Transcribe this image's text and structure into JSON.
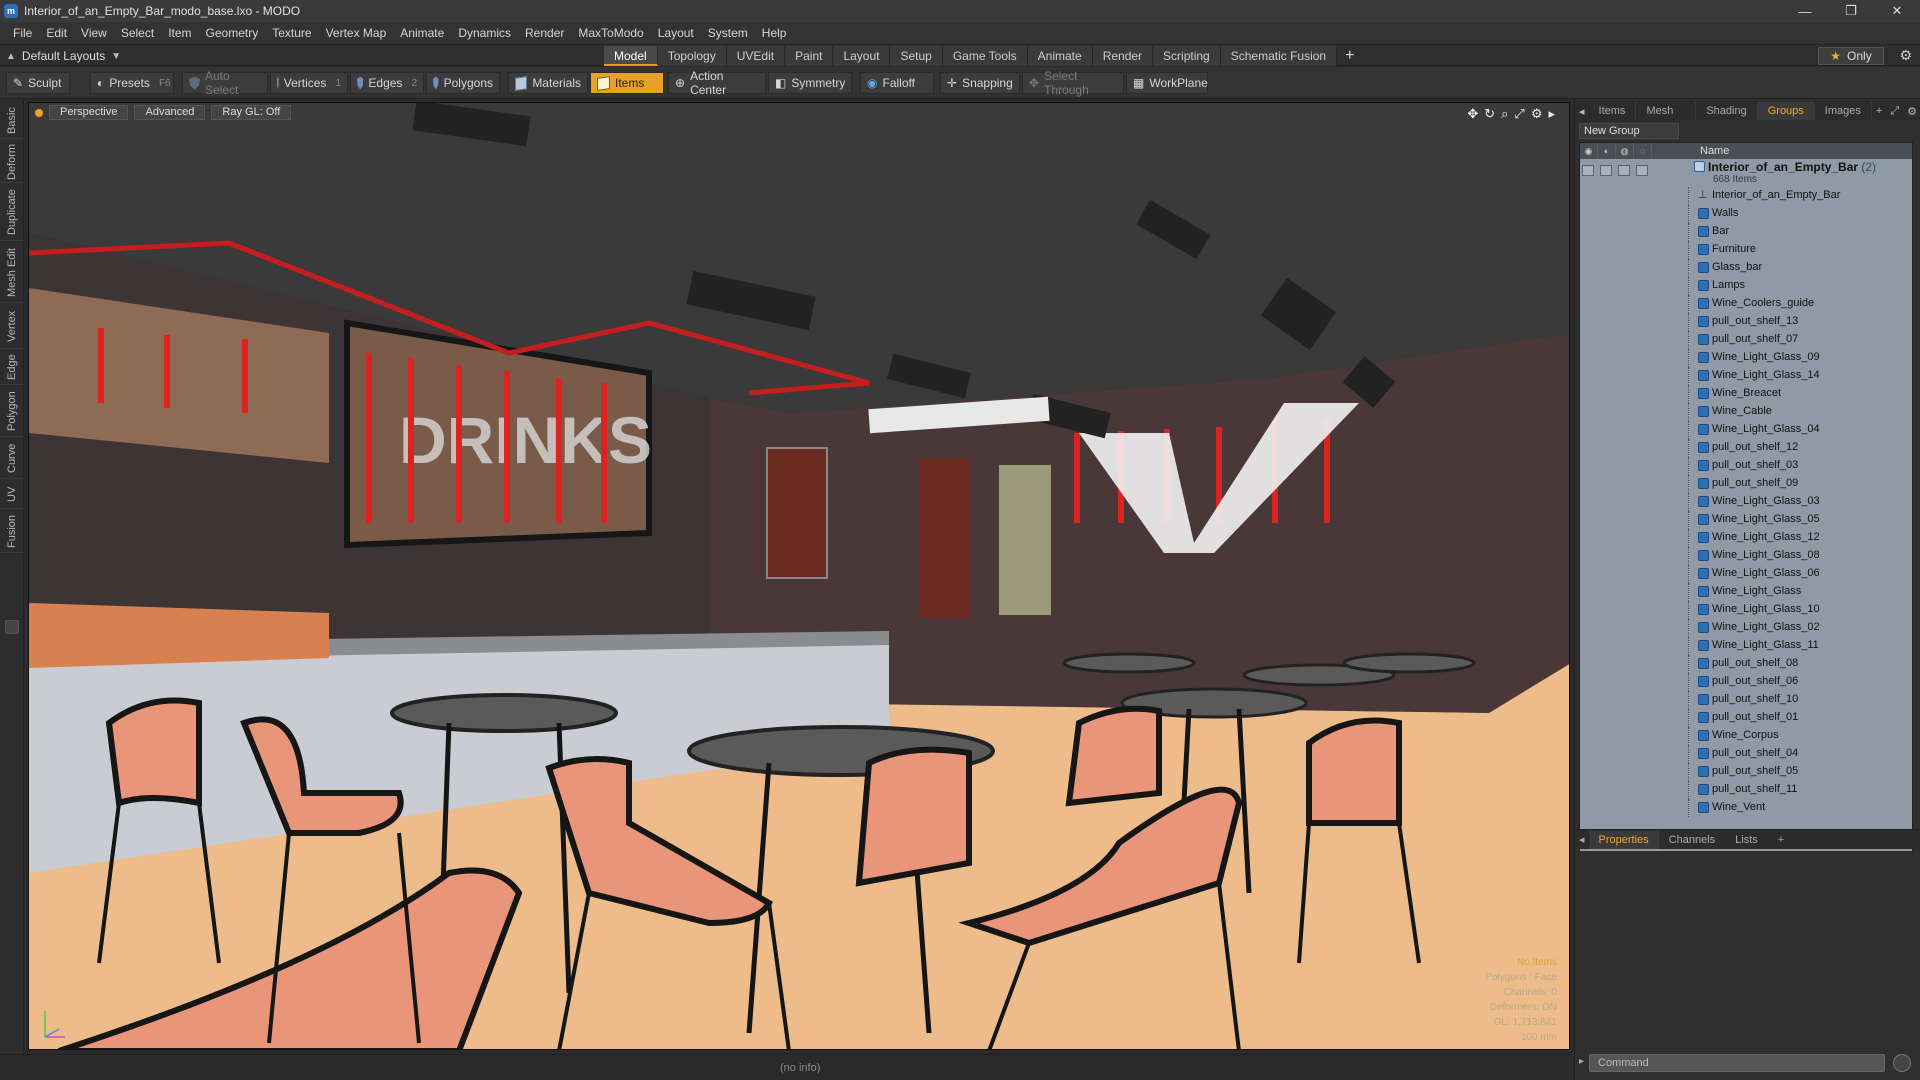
{
  "window": {
    "title": "Interior_of_an_Empty_Bar_modo_base.lxo - MODO",
    "controls": [
      "—",
      "❐",
      "✕"
    ]
  },
  "menu": [
    "File",
    "Edit",
    "View",
    "Select",
    "Item",
    "Geometry",
    "Texture",
    "Vertex Map",
    "Animate",
    "Dynamics",
    "Render",
    "MaxToModo",
    "Layout",
    "System",
    "Help"
  ],
  "layout_select": "Default Layouts",
  "tabs": [
    "Model",
    "Topology",
    "UVEdit",
    "Paint",
    "Layout",
    "Setup",
    "Game Tools",
    "Animate",
    "Render",
    "Scripting",
    "Schematic Fusion"
  ],
  "active_tab": "Model",
  "only_label": "Only",
  "toolbar": {
    "sculpt": "Sculpt",
    "presets": "Presets",
    "presets_key": "F6",
    "auto_select": "Auto Select",
    "vertices": "Vertices",
    "vertices_key": "1",
    "edges": "Edges",
    "edges_key": "2",
    "polygons": "Polygons",
    "materials": "Materials",
    "items": "Items",
    "action_center": "Action Center",
    "symmetry": "Symmetry",
    "falloff": "Falloff",
    "snapping": "Snapping",
    "select_through": "Select Through",
    "workplane": "WorkPlane"
  },
  "left_tabs": [
    "Basic",
    "Deform",
    "Duplicate",
    "Mesh Edit",
    "Vertex",
    "Edge",
    "Polygon",
    "Curve",
    "UV",
    "Fusion"
  ],
  "viewport": {
    "buttons": [
      "Perspective",
      "Advanced",
      "Ray GL: Off"
    ],
    "sign_text": "DRINKS",
    "info": {
      "no_items": "No Items",
      "polygons": "Polygons : Face",
      "channels": "Channels: 0",
      "deformers": "Deformers: ON",
      "gl": "GL: 1,713,641",
      "scale": "100 mm"
    }
  },
  "status": "(no info)",
  "right_panel": {
    "tabs": [
      "Items",
      "Mesh ...",
      "Shading",
      "Groups",
      "Images"
    ],
    "active_tab": "Groups",
    "new_group": "New Group",
    "column_name": "Name",
    "group": {
      "name": "Interior_of_an_Empty_Bar",
      "suffix": "(2)",
      "count": "668 Items"
    },
    "items": [
      "Interior_of_an_Empty_Bar",
      "Walls",
      "Bar",
      "Furniture",
      "Glass_bar",
      "Lamps",
      "Wine_Coolers_guide",
      "pull_out_shelf_13",
      "pull_out_shelf_07",
      "Wine_Light_Glass_09",
      "Wine_Light_Glass_14",
      "Wine_Breacet",
      "Wine_Cable",
      "Wine_Light_Glass_04",
      "pull_out_shelf_12",
      "pull_out_shelf_03",
      "pull_out_shelf_09",
      "Wine_Light_Glass_03",
      "Wine_Light_Glass_05",
      "Wine_Light_Glass_12",
      "Wine_Light_Glass_08",
      "Wine_Light_Glass_06",
      "Wine_Light_Glass",
      "Wine_Light_Glass_10",
      "Wine_Light_Glass_02",
      "Wine_Light_Glass_11",
      "pull_out_shelf_08",
      "pull_out_shelf_06",
      "pull_out_shelf_10",
      "pull_out_shelf_01",
      "Wine_Corpus",
      "pull_out_shelf_04",
      "pull_out_shelf_05",
      "pull_out_shelf_11",
      "Wine_Vent"
    ],
    "props_tabs": [
      "Properties",
      "Channels",
      "Lists"
    ],
    "active_props_tab": "Properties",
    "command_placeholder": "Command"
  },
  "colors": {
    "accent": "#e8a22a",
    "chair": "#e8957a",
    "floor": "#eebb8a",
    "wall_dark": "#4a3a38"
  }
}
